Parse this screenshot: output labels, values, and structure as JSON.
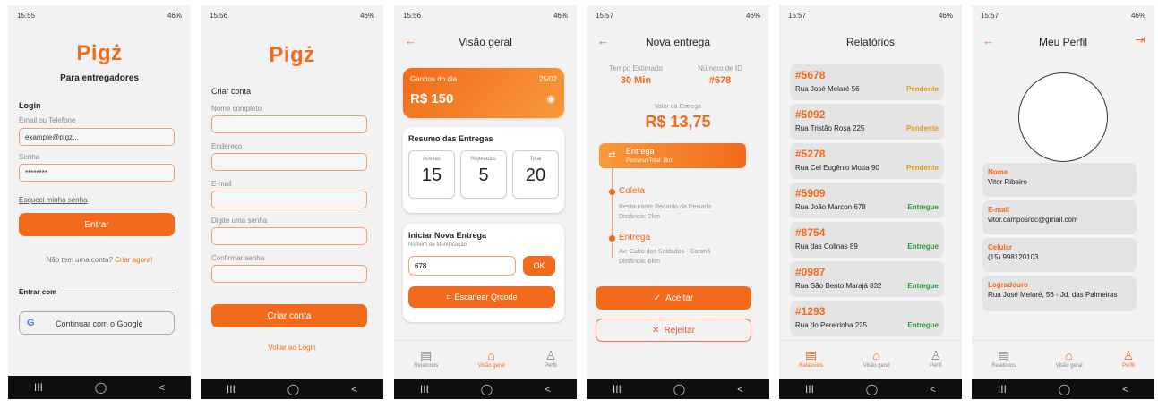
{
  "nav_glyphs": {
    "recent": "III",
    "home": "◯",
    "back": "<"
  },
  "tabs": {
    "reports": "Relatorios",
    "overview": "Visão geral",
    "profile": "Perfil"
  },
  "s1": {
    "time": "15:55",
    "status_right": "46%",
    "logo": "Pigż",
    "subtitle": "Para entregadores",
    "login_title": "Login",
    "email_label": "Email ou Telefone",
    "email_value": "example@pigz...",
    "password_label": "Senha",
    "password_value": "********",
    "forgot": "Esqueci minha senha",
    "enter_btn": "Entrar",
    "no_account": "Não tem uma conta?",
    "create_now": "Criar agora!",
    "enter_with": "Entrar com",
    "google_btn": "Continuar com o Google"
  },
  "s2": {
    "time": "15:56",
    "status_right": "46%",
    "logo": "Pigż",
    "create_title": "Criar conta",
    "name_label": "Nome completo",
    "address_label": "Endereço",
    "email_label": "E-mail",
    "password_label": "Digite uma senha",
    "confirm_label": "Confirmar senha",
    "create_btn": "Criar conta",
    "back_login": "Voltar ao Login"
  },
  "s3": {
    "time": "15:56",
    "status_right": "46%",
    "title": "Visão geral",
    "earn_label": "Ganhos do dia",
    "earn_date": "25/02",
    "earn_value": "R$ 150",
    "summary_title": "Resumo das Entregas",
    "stats": [
      {
        "label": "Aceitas",
        "value": "15"
      },
      {
        "label": "Rejeitadas",
        "value": "5"
      },
      {
        "label": "Total",
        "value": "20"
      }
    ],
    "new_title": "Iniciar Nova Entrega",
    "id_label": "Número de Identificação",
    "id_value": "678",
    "ok_btn": "OK",
    "scan_btn": "Escanear Qrcode"
  },
  "s4": {
    "time": "15:57",
    "status_right": "46%",
    "title": "Nova entrega",
    "time_label": "Tempo Estimado",
    "time_value": "30 Min",
    "id_label": "Número de ID",
    "id_value": "#678",
    "value_label": "Valor da Entrega",
    "value": "R$ 13,75",
    "banner_title": "Entrega",
    "banner_sub": "Percurso Total: 8km",
    "pickup_title": "Coleta",
    "pickup_addr": "Restaurante Recanto da Peixada",
    "pickup_dist": "Distância: 2km",
    "drop_title": "Entrega",
    "drop_addr": "Av: Cabo dos Soldados - Caranã",
    "drop_dist": "Distância: 6km",
    "accept_btn": "Aceitar",
    "reject_btn": "Rejeitar"
  },
  "s5": {
    "time": "15:57",
    "status_right": "46%",
    "title": "Relatórios",
    "status_colors": {
      "Pendente": "#e09a1c",
      "Entregue": "#2e9a3a"
    },
    "reports": [
      {
        "id": "#5678",
        "address": "Rua José Melaré 56",
        "status": "Pendente"
      },
      {
        "id": "#5092",
        "address": "Rua Tristão Rosa 225",
        "status": "Pendente"
      },
      {
        "id": "#5278",
        "address": "Rua Cel Eugênio Motta 90",
        "status": "Pendente"
      },
      {
        "id": "#5909",
        "address": "Rua João Marcon 678",
        "status": "Entregue"
      },
      {
        "id": "#8754",
        "address": "Rua das Colinas 89",
        "status": "Entregue"
      },
      {
        "id": "#0987",
        "address": "Rua São Bento Marajá 832",
        "status": "Entregue"
      },
      {
        "id": "#1293",
        "address": "Rua do Pereirinha 225",
        "status": "Entregue"
      }
    ]
  },
  "s6": {
    "time": "15:57",
    "status_right": "46%",
    "title": "Meu Perfil",
    "fields": [
      {
        "label": "Nome",
        "value": "Vitor Ribeiro"
      },
      {
        "label": "E-mail",
        "value": "vitor.camposrdc@gmail.com"
      },
      {
        "label": "Celular",
        "value": "(15) 998120103"
      },
      {
        "label": "Logradouro",
        "value": "Rua José Melaré, 56 - Jd. das Palmeiras"
      }
    ]
  }
}
